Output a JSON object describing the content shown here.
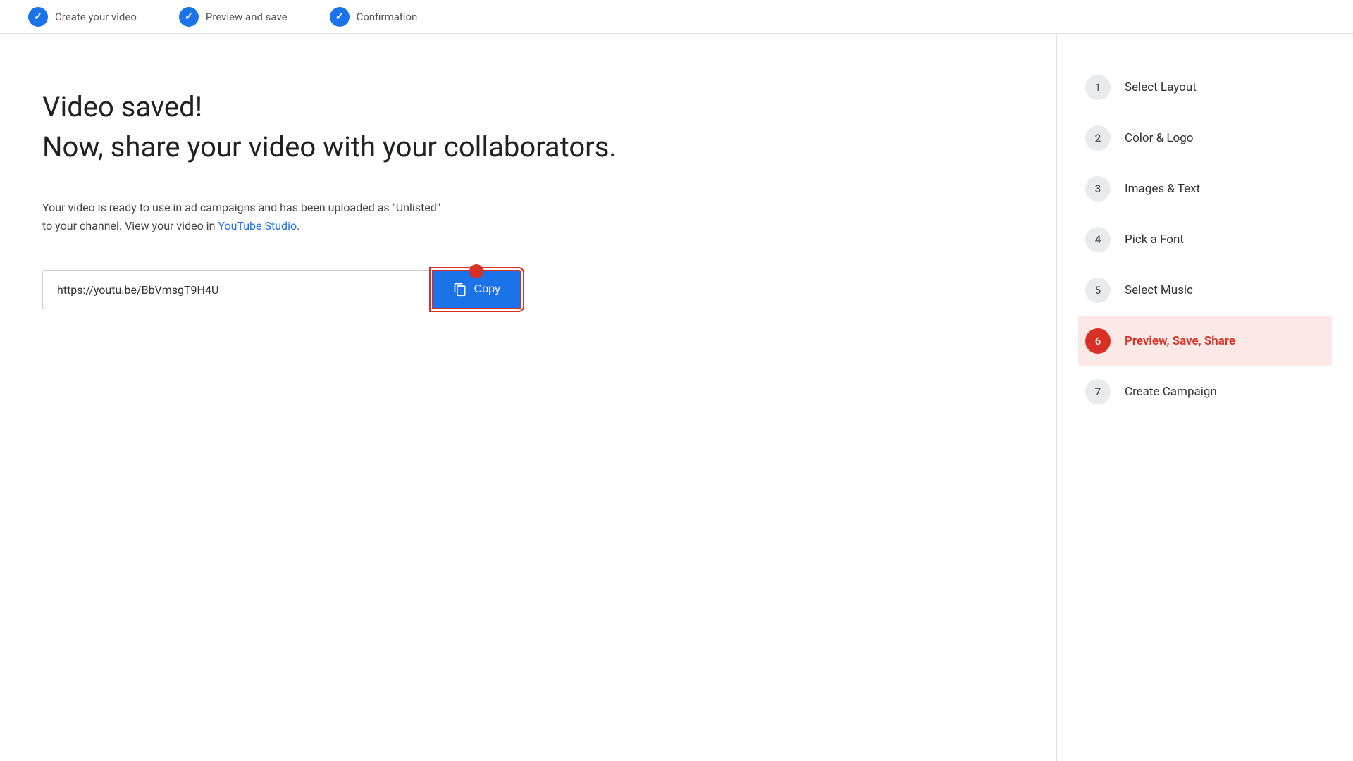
{
  "topBar": {
    "steps": [
      {
        "id": "create-video",
        "label": "Create your video",
        "icon": "check",
        "circleType": "check"
      },
      {
        "id": "preview-save",
        "label": "Preview and save",
        "icon": "check",
        "circleType": "check"
      },
      {
        "id": "confirmation",
        "label": "Confirmation",
        "circleType": "check"
      }
    ]
  },
  "content": {
    "videoSavedLine1": "Video saved!",
    "videoSavedLine2": "Now, share your video with your collaborators.",
    "description1": "Your video is ready to use in ad campaigns and has been uploaded as \"Unlisted\"",
    "description2": "to your channel. View your video in ",
    "youtubeLinkText": "YouTube Studio",
    "descriptionEnd": ".",
    "videoUrl": "https://youtu.be/BbVmsgT9H4U",
    "copyButtonLabel": "Copy"
  },
  "sidebar": {
    "items": [
      {
        "id": "select-layout",
        "number": "1",
        "label": "Select Layout",
        "active": false
      },
      {
        "id": "color-logo",
        "number": "2",
        "label": "Color & Logo",
        "active": false
      },
      {
        "id": "images-text",
        "number": "3",
        "label": "Images & Text",
        "active": false
      },
      {
        "id": "pick-font",
        "number": "4",
        "label": "Pick a Font",
        "active": false
      },
      {
        "id": "select-music",
        "number": "5",
        "label": "Select Music",
        "active": false
      },
      {
        "id": "preview-save-share",
        "number": "6",
        "label": "Preview, Save, Share",
        "active": true
      },
      {
        "id": "create-campaign",
        "number": "7",
        "label": "Create Campaign",
        "active": false
      }
    ]
  }
}
